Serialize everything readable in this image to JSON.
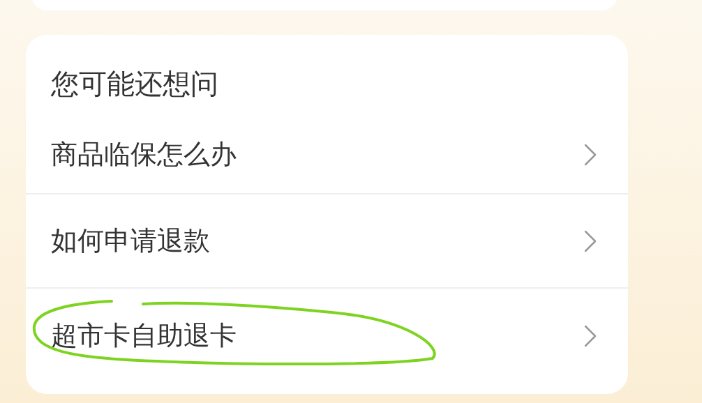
{
  "section_title": "您可能还想问",
  "questions": [
    {
      "label": "商品临保怎么办",
      "annotated": false
    },
    {
      "label": "如何申请退款",
      "annotated": false
    },
    {
      "label": "超市卡自助退卡",
      "annotated": true
    }
  ]
}
